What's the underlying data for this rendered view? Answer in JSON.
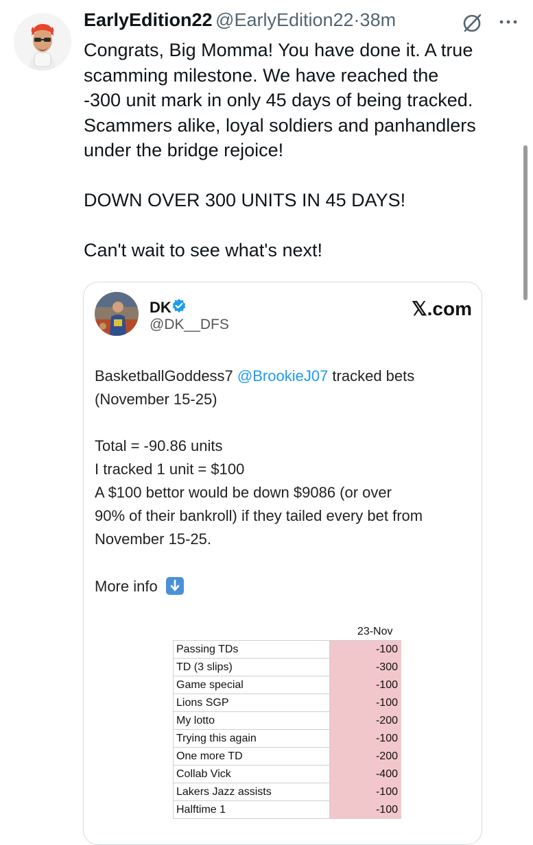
{
  "post": {
    "author_name": "EarlyEdition22",
    "author_handle": "@EarlyEdition22",
    "separator": "·",
    "time": "38m",
    "text": "Congrats, Big Momma! You have done it. A true\nscamming milestone. We have reached the\n-300 unit mark in only 45 days of being tracked.\nScammers alike, loyal soldiers and panhandlers\nunder the bridge rejoice!\n\nDOWN OVER 300 UNITS IN 45 DAYS!\n\nCan't wait to see what's next!",
    "icons": [
      "grok-icon",
      "more-options-icon"
    ]
  },
  "quote": {
    "name": "DK",
    "handle": "@DK__DFS",
    "site": "𝕏.com",
    "line1_prefix": "BasketballGoddess7 ",
    "line1_mention": "@BrookieJ07",
    "line1_suffix": " tracked bets",
    "line2": "(November 15-25)",
    "total": "Total = -90.86 units",
    "tracked": "I tracked 1 unit = $100",
    "bettor1": "A $100 bettor would be down $9086 (or over",
    "bettor2": "90% of their bankroll) if they tailed every bet from",
    "bettor3": "November 15-25.",
    "more_info": "More info",
    "sheet": {
      "date": "23-Nov",
      "rows": [
        {
          "label": "Passing TDs",
          "value": "-100"
        },
        {
          "label": "TD (3 slips)",
          "value": "-300"
        },
        {
          "label": "Game special",
          "value": "-100"
        },
        {
          "label": "Lions SGP",
          "value": "-100"
        },
        {
          "label": "My lotto",
          "value": "-200"
        },
        {
          "label": "Trying this again",
          "value": "-100"
        },
        {
          "label": "One more TD",
          "value": "-200"
        },
        {
          "label": "Collab Vick",
          "value": "-400"
        },
        {
          "label": "Lakers Jazz assists",
          "value": "-100"
        },
        {
          "label": "Halftime 1",
          "value": "-100"
        }
      ],
      "negative_fill": "#f1c7cb"
    }
  },
  "colors": {
    "link": "#1d9bf0",
    "handle": "#536471",
    "text": "#0f1419"
  }
}
